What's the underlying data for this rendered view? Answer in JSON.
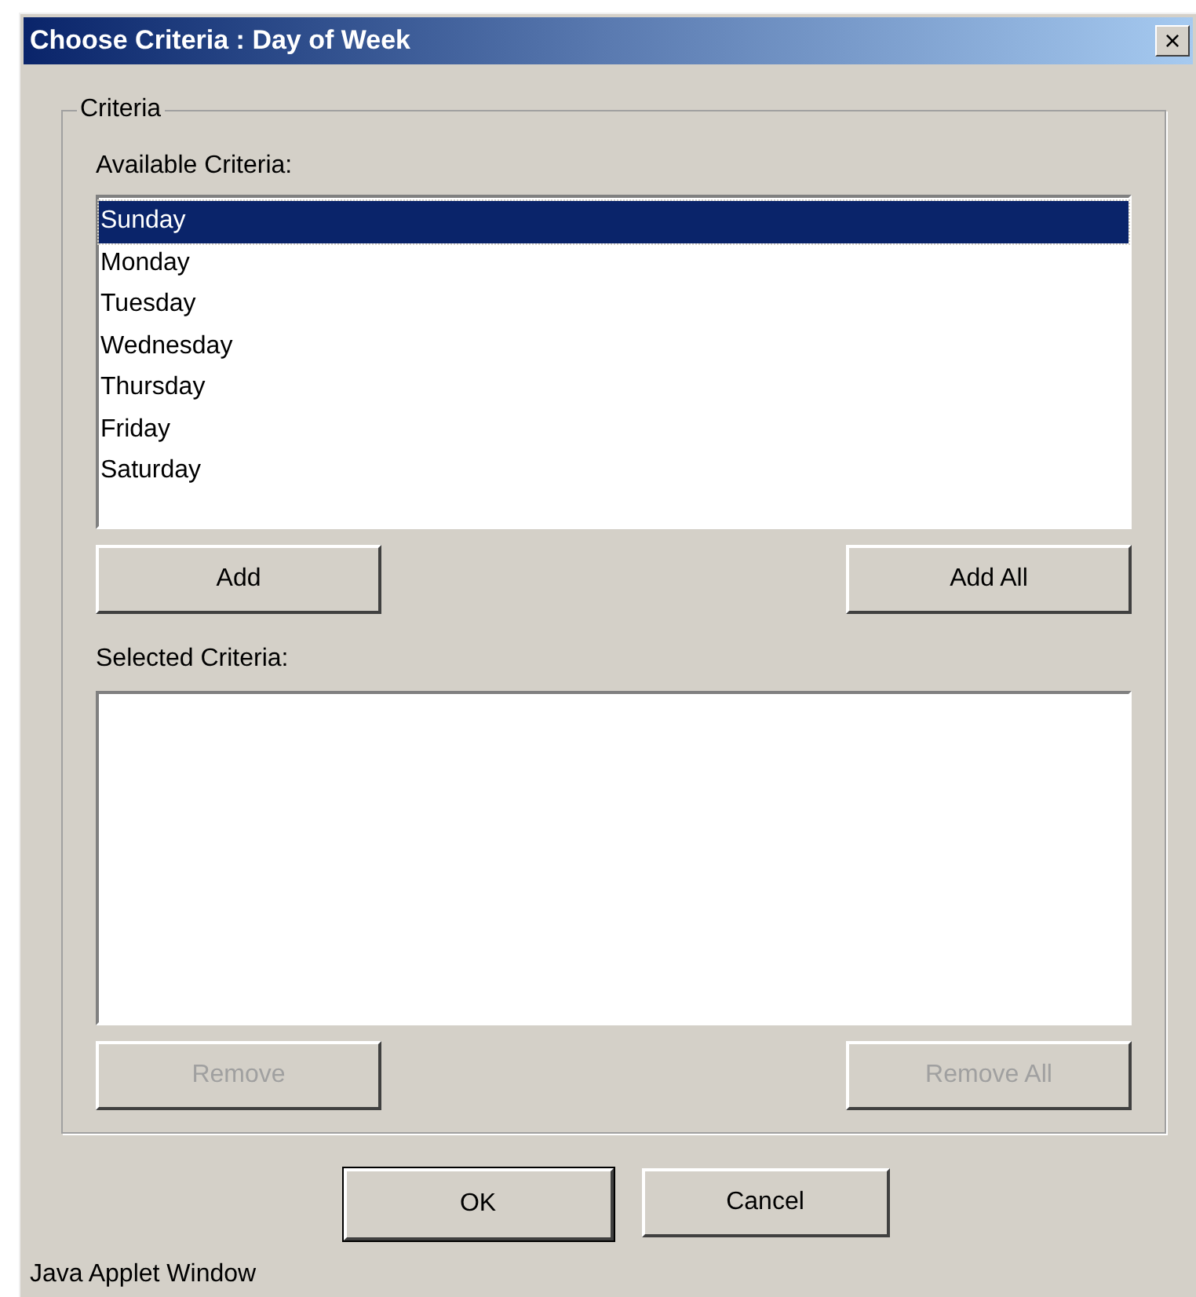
{
  "window": {
    "title": "Choose Criteria : Day of Week",
    "close": "×"
  },
  "group": {
    "title": "Criteria"
  },
  "available": {
    "label": "Available Criteria:",
    "items": [
      {
        "label": "Sunday",
        "selected": true
      },
      {
        "label": "Monday",
        "selected": false
      },
      {
        "label": "Tuesday",
        "selected": false
      },
      {
        "label": "Wednesday",
        "selected": false
      },
      {
        "label": "Thursday",
        "selected": false
      },
      {
        "label": "Friday",
        "selected": false
      },
      {
        "label": "Saturday",
        "selected": false
      }
    ]
  },
  "add_buttons": [
    {
      "label": "Add",
      "disabled": false
    },
    {
      "label": "Add All",
      "disabled": false
    }
  ],
  "selected": {
    "label": "Selected Criteria:"
  },
  "remove_buttons": [
    {
      "label": "Remove",
      "disabled": true
    },
    {
      "label": "Remove All",
      "disabled": true
    }
  ],
  "dialog_buttons": [
    {
      "label": "OK",
      "default": true
    },
    {
      "label": "Cancel",
      "default": false
    }
  ],
  "status_bar": "Java Applet Window"
}
